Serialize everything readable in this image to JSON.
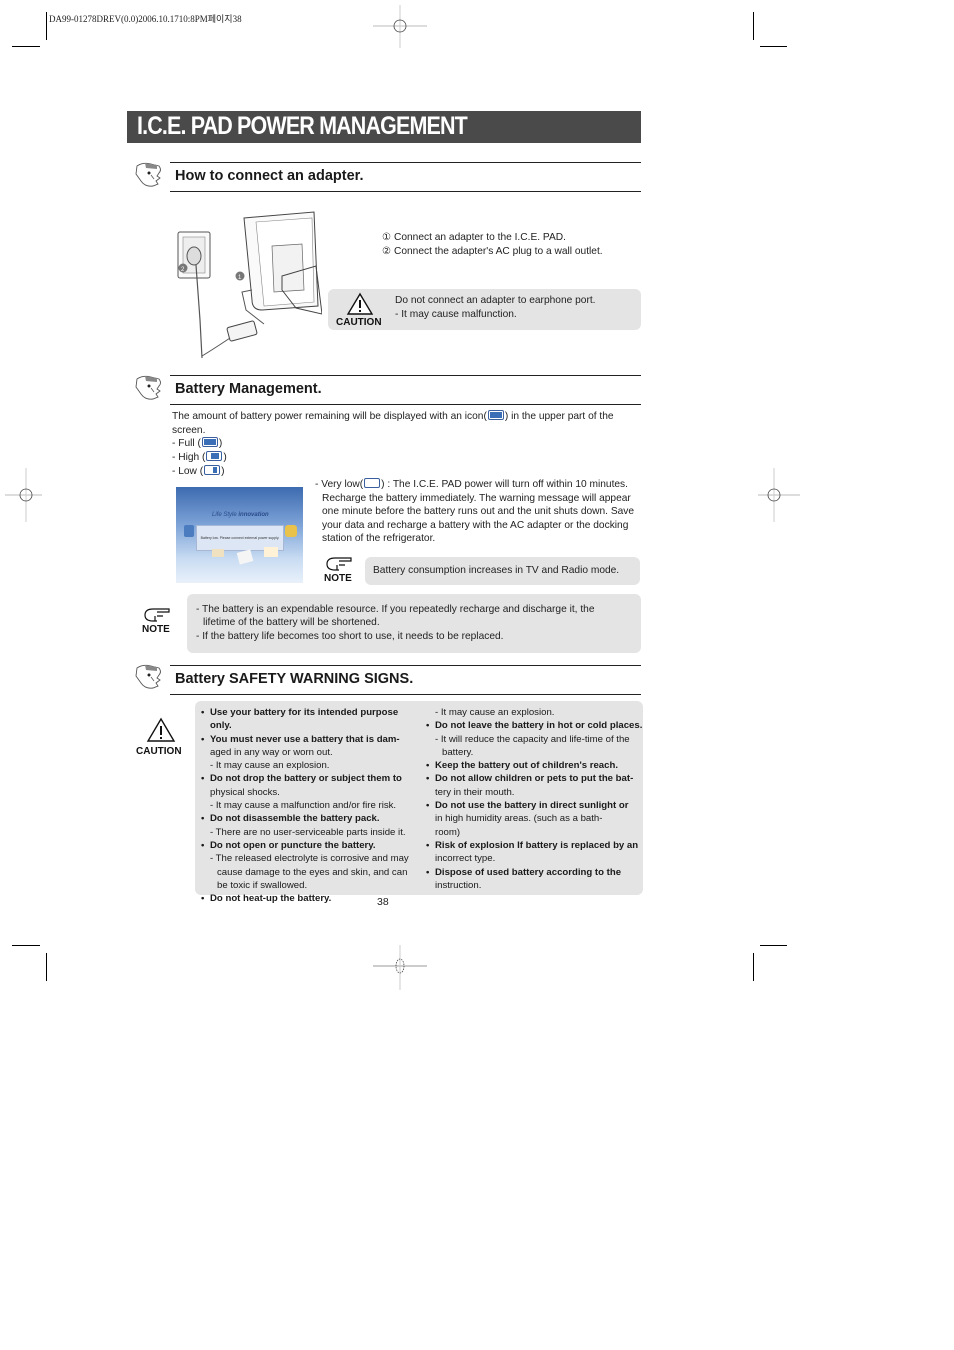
{
  "print_header": "DA99-01278DREV(0.0)2006.10.1710:8PM페이지38",
  "page_title": "I.C.E. PAD POWER MANAGEMENT",
  "sections": {
    "adapter": {
      "heading": "How to connect an adapter.",
      "steps": [
        "① Connect an adapter to the I.C.E. PAD.",
        "② Connect the adapter's AC plug to a wall outlet."
      ],
      "caution": {
        "label": "CAUTION",
        "lines": [
          "Do not connect an adapter to earphone port.",
          "- It may cause malfunction."
        ]
      },
      "callouts": [
        "1",
        "2"
      ]
    },
    "battery": {
      "heading": "Battery Management.",
      "intro_line1_a": "The amount of battery power remaining will be displayed with an icon(",
      "intro_line1_b": ") in the upper part of the",
      "intro_line2": "screen.",
      "levels": [
        {
          "label": "- Full (",
          "fill": 1.0
        },
        {
          "label": "- High (",
          "fill": 0.66
        },
        {
          "label": "- Low (",
          "fill": 0.33
        }
      ],
      "very_low": {
        "prefix": "- Very low(",
        "lines": [
          ") : The I.C.E. PAD power will turn off within 10 minutes.",
          "Recharge the battery immediately. The warning message will appear",
          "one minute before the battery runs out and the unit shuts down. Save",
          "your data and recharge a battery with the AC adapter or the docking",
          "station of the refrigerator."
        ]
      },
      "screenshot": {
        "brand": "Life Style",
        "brand_logo": "innovation",
        "dialog": "Battery low. Please connect external power supply."
      },
      "note_small": {
        "label": "NOTE",
        "text": "Battery consumption increases in TV and Radio mode."
      },
      "note_large": {
        "label": "NOTE",
        "lines": [
          "- The battery is an expendable resource. If you repeatedly recharge and discharge it, the",
          "lifetime of the battery will be shortened.",
          "- If the battery life becomes too short to use, it needs to be replaced."
        ]
      }
    },
    "safety": {
      "heading": "Battery SAFETY WARNING SIGNS.",
      "caution_label": "CAUTION",
      "left_column": [
        {
          "type": "b",
          "text": "Use your battery for its intended purpose only."
        },
        {
          "type": "b",
          "text": "You must never use a battery that is     dam-"
        },
        {
          "type": "s",
          "text": "aged in any way or worn out."
        },
        {
          "type": "sub",
          "text": "- It may cause an explosion."
        },
        {
          "type": "b",
          "text": "Do not drop the battery or subject them to"
        },
        {
          "type": "s",
          "text": "physical shocks."
        },
        {
          "type": "sub",
          "text": "- It may cause a malfunction and/or fire risk."
        },
        {
          "type": "b",
          "text": "Do not disassemble the battery pack."
        },
        {
          "type": "sub",
          "text": "- There are no user-serviceable parts inside it."
        },
        {
          "type": "b",
          "text": "Do not open or puncture the battery."
        },
        {
          "type": "sub",
          "text": "- The released electrolyte is corrosive and may"
        },
        {
          "type": "sub2",
          "text": "cause damage to the eyes and skin, and can"
        },
        {
          "type": "sub2",
          "text": "be toxic if swallowed."
        },
        {
          "type": "b",
          "text": "Do not heat-up the battery."
        }
      ],
      "right_column": [
        {
          "type": "sub",
          "text": "- It may cause an explosion."
        },
        {
          "type": "b",
          "text": "Do not leave the battery in hot or cold places."
        },
        {
          "type": "sub",
          "text": "- It will reduce the capacity and life-time of the"
        },
        {
          "type": "sub2",
          "text": "battery."
        },
        {
          "type": "b",
          "text": "Keep the battery out of children's reach."
        },
        {
          "type": "b",
          "text": "Do not allow children or pets to put the bat-"
        },
        {
          "type": "s",
          "text": "tery in their mouth."
        },
        {
          "type": "b",
          "text": "Do not use the battery in direct sunlight or"
        },
        {
          "type": "s",
          "text": "in high humidity areas. (such as a bath-"
        },
        {
          "type": "s",
          "text": "room)"
        },
        {
          "type": "b",
          "text": "Risk of explosion If battery is replaced by an"
        },
        {
          "type": "s",
          "text": "incorrect type."
        },
        {
          "type": "b",
          "text": "Dispose of used battery according to the"
        },
        {
          "type": "s",
          "text": "instruction."
        }
      ]
    }
  },
  "page_number": "38",
  "colors": {
    "title_bar": "#4a4a4a",
    "box_gray": "#e4e4e4",
    "battery_icon": "#3a6fb8"
  }
}
